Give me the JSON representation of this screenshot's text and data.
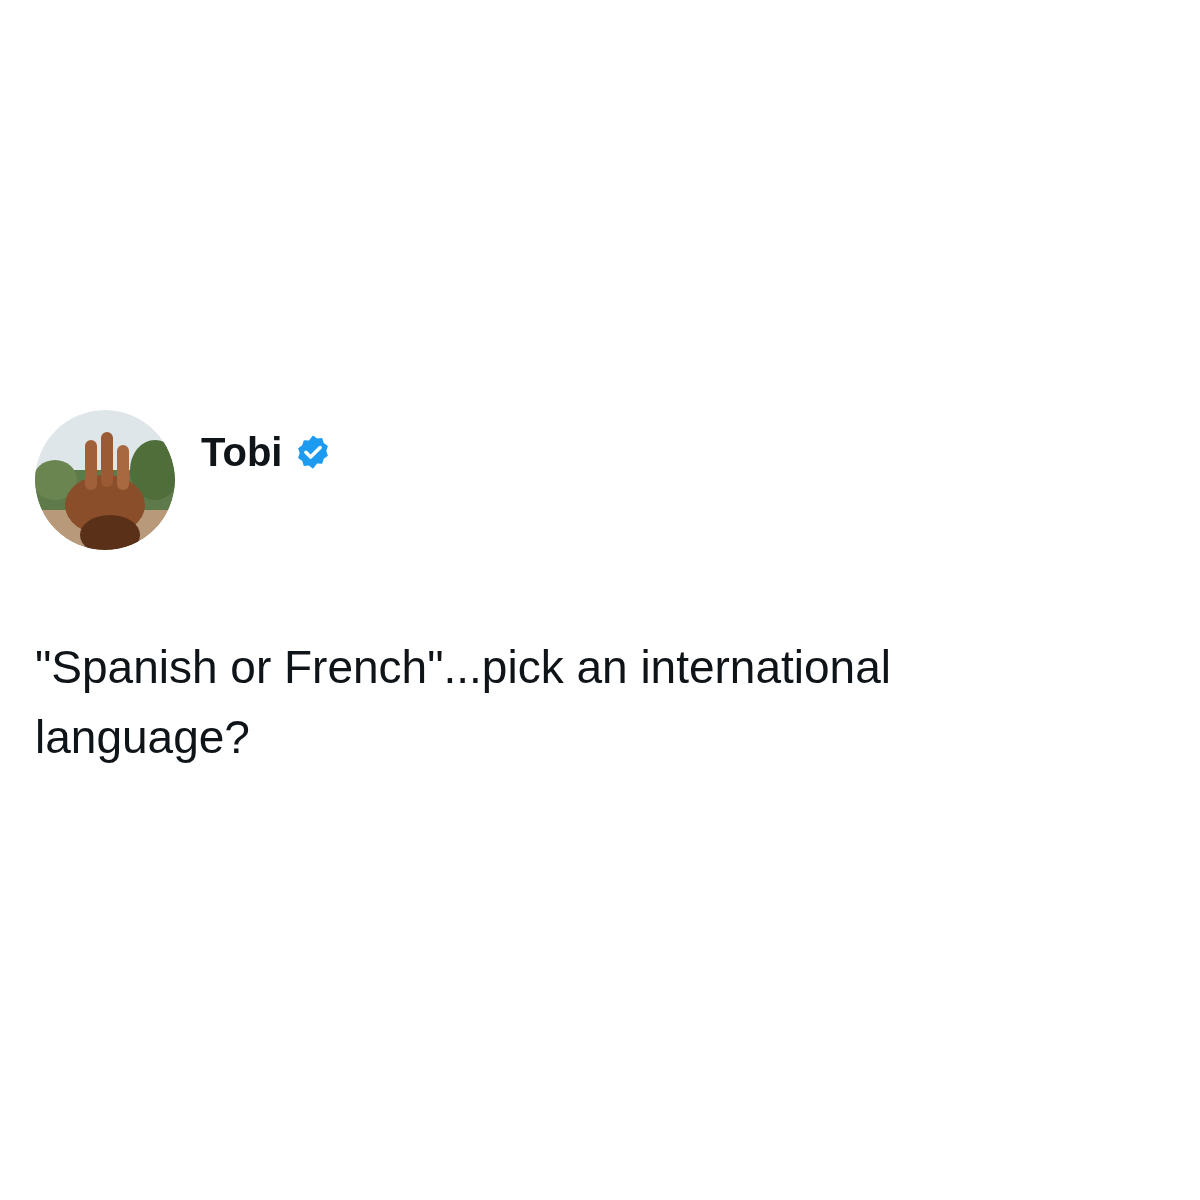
{
  "tweet": {
    "author": {
      "name": "Tobi",
      "verified": true
    },
    "text": "\"Spanish or French\"...pick an international language?"
  }
}
